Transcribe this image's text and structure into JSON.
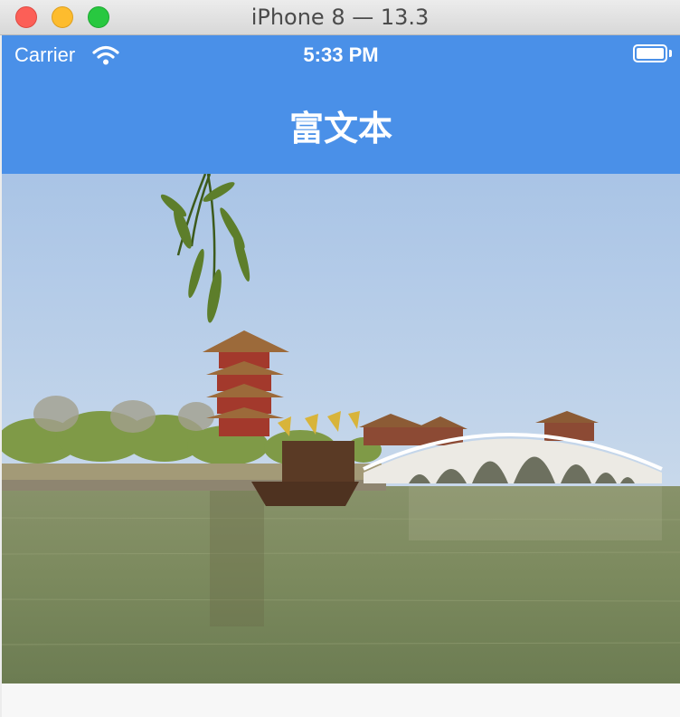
{
  "window": {
    "title": "iPhone 8 — 13.3"
  },
  "status_bar": {
    "carrier": "Carrier",
    "time": "5:33 PM"
  },
  "nav": {
    "title": "富文本"
  },
  "colors": {
    "accent": "#4a90e8"
  },
  "icons": {
    "wifi": "wifi-icon",
    "battery": "battery-icon"
  }
}
